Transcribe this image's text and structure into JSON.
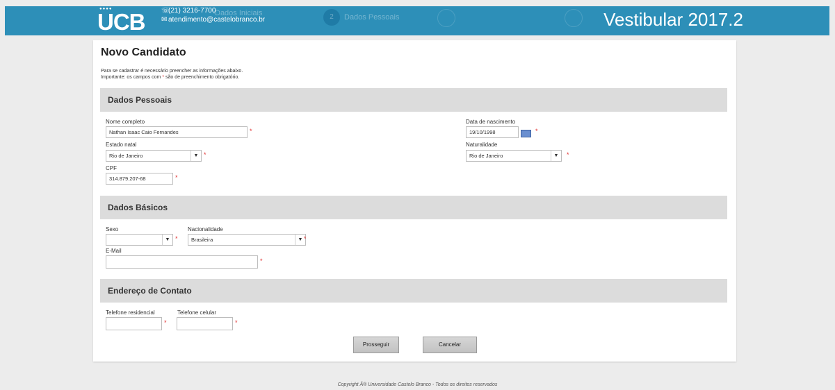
{
  "header": {
    "logo_dots": "●●●●",
    "logo_text": "UCB",
    "phone": "(21) 3216-7700",
    "email": "atendimento@castelobranco.br",
    "steps": [
      {
        "number": "",
        "label": "Dados Iniciais"
      },
      {
        "number": "2",
        "label": "Dados Pessoais"
      },
      {
        "number": "",
        "label": ""
      },
      {
        "number": "",
        "label": ""
      }
    ],
    "title": "Vestibular 2017.2"
  },
  "page": {
    "title": "Novo Candidato",
    "intro_line1": "Para se cadastrar é necessário preencher as informações abaixo.",
    "intro_line2_a": "Importante: os campos com ",
    "intro_line2_star": "*",
    "intro_line2_b": " são de preenchimento obrigatório."
  },
  "sections": {
    "pessoais": "Dados Pessoais",
    "basicos": "Dados Básicos",
    "endereco": "Endereço de Contato"
  },
  "form": {
    "required_mark": "*",
    "nome_label": "Nome completo",
    "nome_value": "Nathan Isaac Caio Fernandes",
    "nascimento_label": "Data de nascimento",
    "nascimento_value": "19/10/1998",
    "estado_label": "Estado natal",
    "estado_value": "Rio de Janeiro",
    "naturalidade_label": "Naturalidade",
    "naturalidade_value": "Rio de Janeiro",
    "cpf_label": "CPF",
    "cpf_value": "314.879.207-68",
    "sexo_label": "Sexo",
    "sexo_value": "",
    "nacionalidade_label": "Nacionalidade",
    "nacionalidade_value": "Brasileira",
    "email_label": "E-Mail",
    "email_value": "",
    "tel_res_label": "Telefone residencial",
    "tel_res_value": "",
    "tel_cel_label": "Telefone celular",
    "tel_cel_value": "",
    "arrow": "▼"
  },
  "buttons": {
    "proceed": "Prosseguir",
    "cancel": "Cancelar"
  },
  "footer": "Copyright Â® Universidade Castelo Branco - Todos os direitos reservados",
  "colors": {
    "header": "#2d8fb8",
    "required": "#e03030",
    "section": "#dcdcdc"
  }
}
